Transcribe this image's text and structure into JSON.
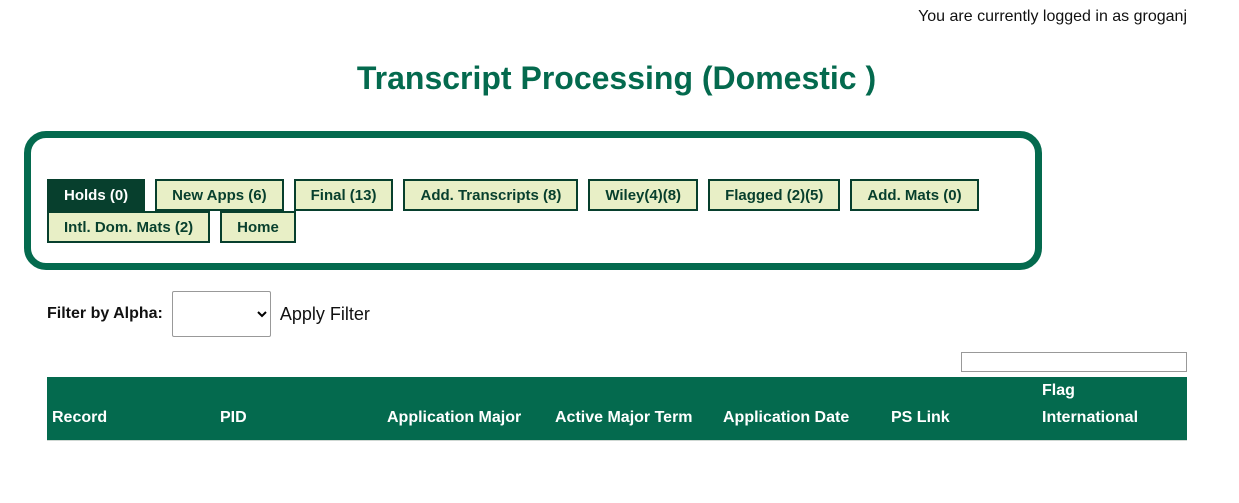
{
  "header": {
    "login_status": "You are currently logged in as groganj",
    "title": "Transcript Processing (Domestic )"
  },
  "tabs": [
    {
      "label": "Holds (0)",
      "active": true
    },
    {
      "label": "New Apps (6)",
      "active": false
    },
    {
      "label": "Final (13)",
      "active": false
    },
    {
      "label": "Add. Transcripts (8)",
      "active": false
    },
    {
      "label": "Wiley(4)(8)",
      "active": false
    },
    {
      "label": "Flagged (2)(5)",
      "active": false
    },
    {
      "label": "Add. Mats (0)",
      "active": false
    },
    {
      "label": "Intl. Dom. Mats (2)",
      "active": false
    },
    {
      "label": "Home",
      "active": false
    }
  ],
  "filter": {
    "label": "Filter by Alpha:",
    "selected_value": "",
    "apply_label": "Apply Filter"
  },
  "search": {
    "value": ""
  },
  "table": {
    "columns": [
      {
        "label": "Record"
      },
      {
        "label": "PID"
      },
      {
        "label": "Application Major"
      },
      {
        "label": "Active Major Term"
      },
      {
        "label": "Application Date"
      },
      {
        "label": "PS Link"
      },
      {
        "label_line1": "Flag",
        "label_line2": "International"
      }
    ],
    "rows": []
  },
  "colors": {
    "brand_green": "#046a4e",
    "tab_dark": "#073f2d",
    "tab_light": "#e8efc6"
  }
}
